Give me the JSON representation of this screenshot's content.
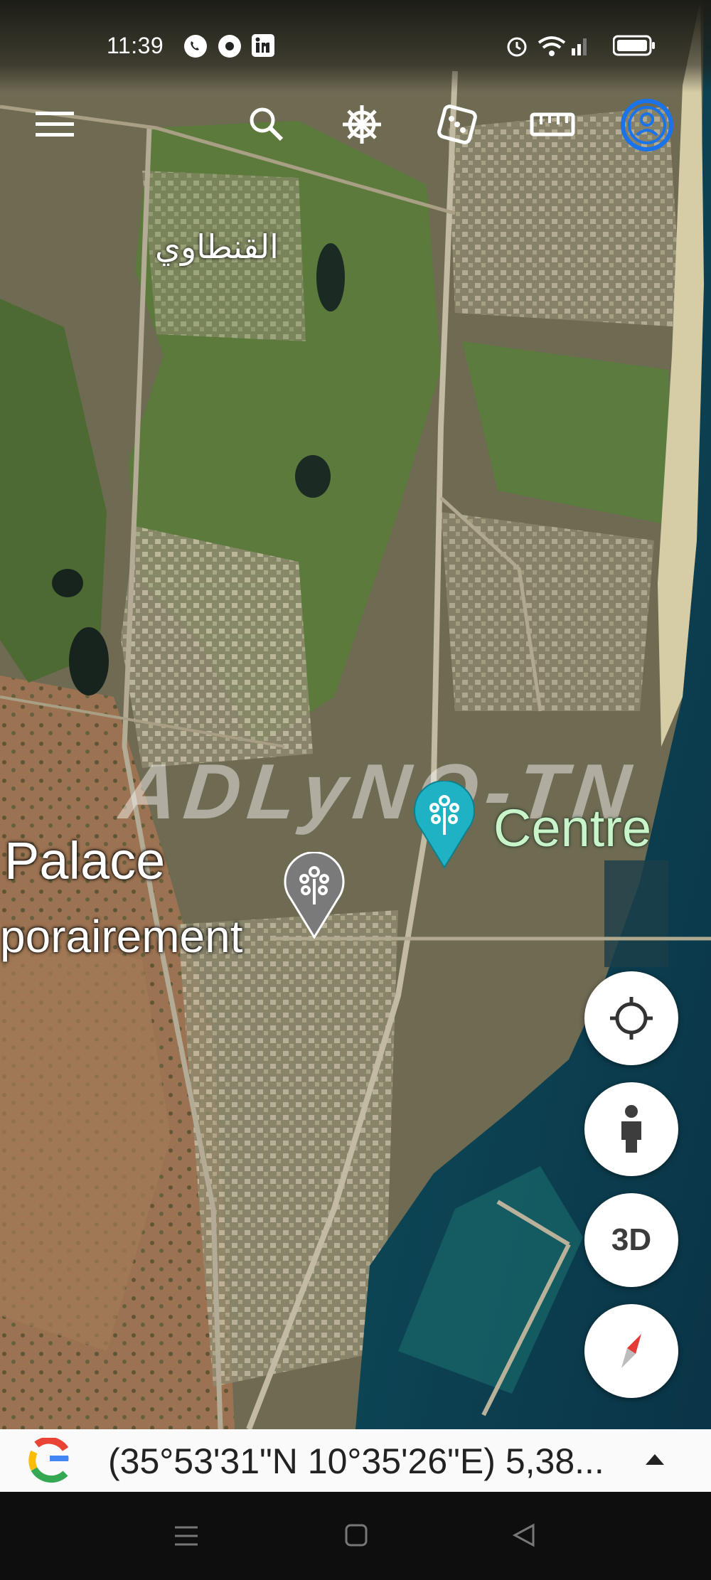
{
  "status_bar": {
    "time": "11:39",
    "left_icons": [
      "whatsapp-phone-icon",
      "chrome-icon",
      "linkedin-icon"
    ],
    "right_icons": [
      "alarm-icon",
      "wifi-icon",
      "signal-icon",
      "battery-icon"
    ]
  },
  "toolbar": {
    "items": [
      "menu-icon",
      "search-icon",
      "voyager-helm-icon",
      "feeling-lucky-dice-icon",
      "measure-ruler-icon",
      "account-avatar-icon"
    ]
  },
  "map": {
    "arabic_label": "القنطاوي",
    "labels": {
      "palace": "Palace",
      "temporairement": "porairement",
      "centre": "Centre"
    },
    "watermark": "ADLyNO-TN",
    "colors": {
      "active_pin": "#1fb2c4",
      "inactive_pin": "#7a7a7a",
      "account_ring": "#1a73e8"
    }
  },
  "controls": {
    "my_location": "crosshair-icon",
    "street_view": "pegman-icon",
    "three_d_label": "3D",
    "compass": "compass-icon"
  },
  "bottom_bar": {
    "logo": "google-g-logo",
    "coordinates": "(35°53'31\"N 10°35'26\"E) 5,38...",
    "expand": "caret-up-icon"
  },
  "nav_bar": {
    "buttons": [
      "recent-apps-icon",
      "home-icon",
      "back-icon"
    ]
  }
}
